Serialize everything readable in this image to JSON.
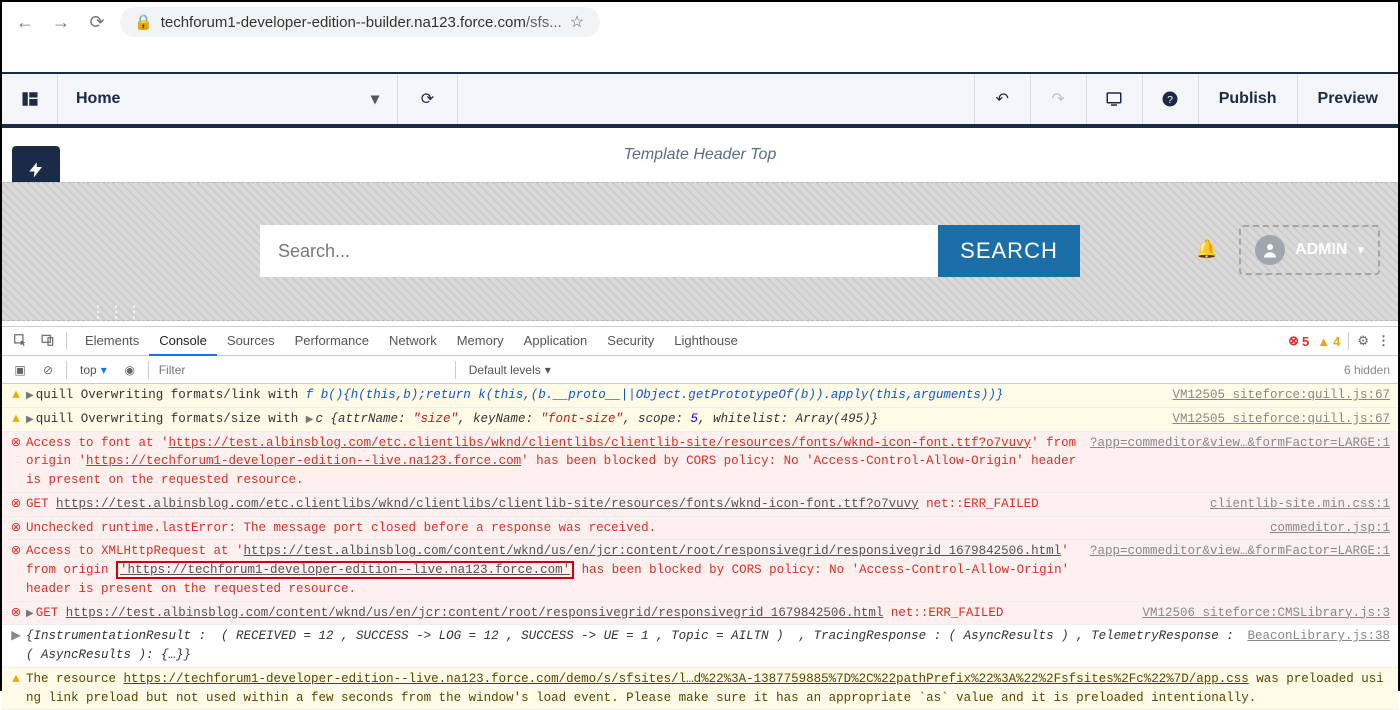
{
  "chrome": {
    "url_host": "techforum1-developer-edition--builder.na123.force.com",
    "url_path": "/sfs..."
  },
  "builder": {
    "page_selector": "Home",
    "publish": "Publish",
    "preview": "Preview"
  },
  "canvas": {
    "template_header": "Template Header Top",
    "search_placeholder": "Search...",
    "search_button": "SEARCH",
    "admin_label": "ADMIN"
  },
  "devtools": {
    "tabs": [
      "Elements",
      "Console",
      "Sources",
      "Performance",
      "Network",
      "Memory",
      "Application",
      "Security",
      "Lighthouse"
    ],
    "active_tab": "Console",
    "error_count": "5",
    "warn_count": "4",
    "filter": {
      "scope": "top",
      "placeholder": "Filter",
      "levels": "Default levels",
      "hidden": "6 hidden"
    }
  },
  "console": {
    "rows": [
      {
        "type": "warn",
        "src": "VM12505 siteforce:quill.js:67",
        "prefix": "quill Overwriting formats/link with ",
        "fn": "f b(){h(this,b);return k(this,(b.__proto__||Object.getPrototypeOf(b)).apply(this,arguments))}"
      },
      {
        "type": "warn",
        "src": "VM12505 siteforce:quill.js:67",
        "prefix": "quill Overwriting formats/size with ",
        "obj_lead": "c ",
        "obj_body_1": "{attrName: ",
        "obj_v1": "\"size\"",
        "obj_body_2": ", keyName: ",
        "obj_v2": "\"font-size\"",
        "obj_body_3": ", scope: ",
        "obj_v3": "5",
        "obj_body_4": ", whitelist: ",
        "obj_v4": "Array(495)",
        "obj_body_5": "}"
      },
      {
        "type": "err",
        "src": "?app=commeditor&view…&formFactor=LARGE:1",
        "t1": "Access to font at '",
        "u1": "https://test.albinsblog.com/etc.clientlibs/wknd/clientlibs/clientlib-site/resources/fonts/wknd-icon-font.ttf?o7vuvy",
        "t2": "' from origin '",
        "u2": "https://techforum1-developer-edition--live.na123.force.com",
        "t3": "' has been blocked by CORS policy: No 'Access-Control-Allow-Origin' header is present on the requested resource."
      },
      {
        "type": "err",
        "src": "clientlib-site.min.css:1",
        "t1": "GET ",
        "u1": "https://test.albinsblog.com/etc.clientlibs/wknd/clientlibs/clientlib-site/resources/fonts/wknd-icon-font.ttf?o7vuvy",
        "t2": " net::ERR_FAILED"
      },
      {
        "type": "err",
        "src": "commeditor.jsp:1",
        "t1": "Unchecked runtime.lastError: The message port closed before a response was received."
      },
      {
        "type": "err",
        "src": "?app=commeditor&view…&formFactor=LARGE:1",
        "t1": "Access to XMLHttpRequest at '",
        "u1": "https://test.albinsblog.com/content/wknd/us/en/jcr:content/root/responsivegrid/responsivegrid_1679842506.html",
        "t2": "' from origin ",
        "ubox": "'https://techforum1-developer-edition--live.na123.force.com'",
        "t3": " has been blocked by CORS policy: No 'Access-Control-Allow-Origin' header is present on the requested resource."
      },
      {
        "type": "err",
        "src": "VM12506 siteforce:CMSLibrary.js:3",
        "tri": "▶",
        "t1": "GET ",
        "u1": "https://test.albinsblog.com/content/wknd/us/en/jcr:content/root/responsivegrid/responsivegrid_1679842506.html",
        "t2": " net::ERR_FAILED"
      },
      {
        "type": "log",
        "src": "BeaconLibrary.js:38",
        "body": "{InstrumentationResult :  ( RECEIVED = 12 , SUCCESS -> LOG = 12 , SUCCESS -> UE = 1 , Topic = AILTN )  , TracingResponse : ( AsyncResults ) , TelemetryResponse : ( AsyncResults ): {…}}"
      },
      {
        "type": "warn",
        "t1": "The resource ",
        "u1": "https://techforum1-developer-edition--live.na123.force.com/demo/s/sfsites/l…d%22%3A-1387759885%7D%2C%22pathPrefix%22%3A%22%2Fsfsites%2Fc%22%7D/app.css",
        "t2": " was preloaded using link preload but not used within a few seconds from the window's load event. Please make sure it has an appropriate `as` value and it is preloaded intentionally."
      }
    ]
  }
}
